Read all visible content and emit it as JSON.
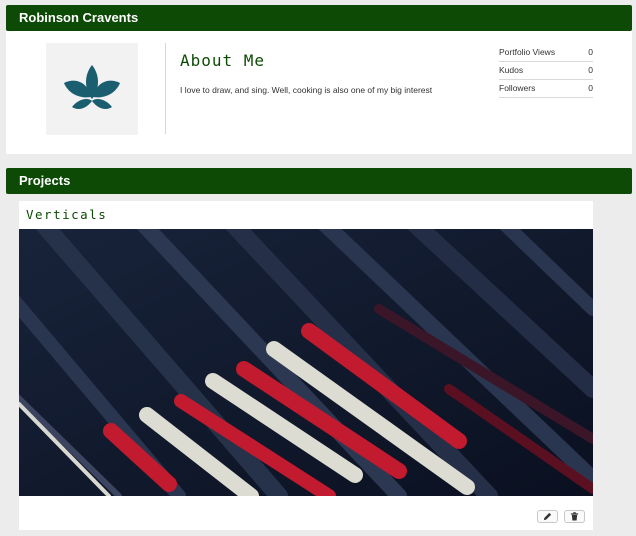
{
  "profile": {
    "name": "Robinson Cravents",
    "about_title": "About Me",
    "about_text": "I love to draw, and sing. Well, cooking is also one of my big interest",
    "avatar_icon": "leaf-logo-icon",
    "stats": [
      {
        "label": "Portfolio Views",
        "value": "0"
      },
      {
        "label": "Kudos",
        "value": "0"
      },
      {
        "label": "Followers",
        "value": "0"
      }
    ]
  },
  "projects": {
    "heading": "Projects",
    "items": [
      {
        "title": "Verticals",
        "image": "abstract-diagonal-stripes-image",
        "actions": [
          {
            "name": "edit",
            "icon": "pencil-icon"
          },
          {
            "name": "delete",
            "icon": "trash-icon"
          }
        ]
      }
    ]
  },
  "colors": {
    "header_green": "#0d4a05",
    "logo_teal": "#1b5e70",
    "stripe_red": "#c21a2e",
    "stripe_white": "#dcdcd2",
    "image_dark": "#0f1a2e"
  }
}
